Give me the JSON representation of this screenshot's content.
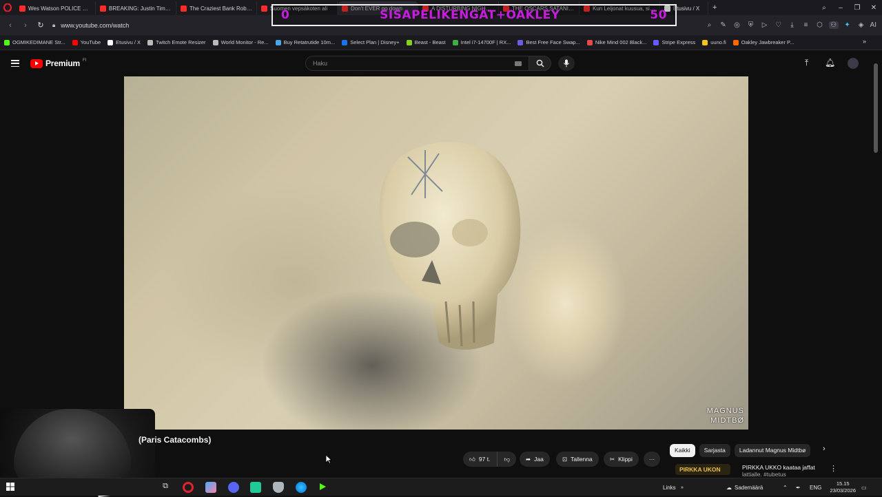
{
  "browser": {
    "tabs": [
      {
        "label": "Wes Watson POLICE REPO",
        "color": "#ff2b2b"
      },
      {
        "label": "BREAKING: Justin Timberl",
        "color": "#ff2b2b"
      },
      {
        "label": "The Craziest Bank Robber",
        "color": "#ff2b2b"
      },
      {
        "label": "Suomen vepsäkoten ali",
        "color": "#ff2b2b"
      },
      {
        "label": "Don't EVER go down",
        "color": "#ff2b2b"
      },
      {
        "label": "A DISTURBING NIGHT SH",
        "color": "#ff2b2b"
      },
      {
        "label": "THE OSCARS SATANIC R",
        "color": "#ff2b2b"
      },
      {
        "label": "Kun Leijonat kuusua, siito",
        "color": "#ff2b2b"
      },
      {
        "label": "Etusivu / X",
        "color": "#ffffff"
      }
    ],
    "new_tab": "+",
    "url": "www.youtube.com/watch",
    "ai_label": "AI",
    "bookmarks": [
      {
        "label": "OGMIKEDIMANE Str...",
        "color": "#53fc18"
      },
      {
        "label": "YouTube",
        "color": "#ff0000"
      },
      {
        "label": "Etusivu / X",
        "color": "#ffffff"
      },
      {
        "label": "Twitch Emote Resizer",
        "color": "#bbbbbb"
      },
      {
        "label": "World Monitor - Re...",
        "color": "#bbbbbb"
      },
      {
        "label": "Buy Retatrutide 10m...",
        "color": "#49a6e9"
      },
      {
        "label": "Select Plan | Disney+",
        "color": "#1a73e8"
      },
      {
        "label": "Beast - Beast",
        "color": "#7ed321"
      },
      {
        "label": "Intel i7-14700F | RX...",
        "color": "#3cb043"
      },
      {
        "label": "Best Free Face Swap...",
        "color": "#6b5ce7"
      },
      {
        "label": "Nike Mind 002 Black...",
        "color": "#e34b4b"
      },
      {
        "label": "Stripe Express",
        "color": "#635bff"
      },
      {
        "label": "uuno.fi",
        "color": "#f5c518"
      },
      {
        "label": "Oakley Jawbreaker P...",
        "color": "#ff6a00"
      }
    ]
  },
  "overlay": {
    "left": "0",
    "center": "SISAPELIKENGÄT+OAKLEY",
    "right": "50"
  },
  "youtube": {
    "brand": "Premium",
    "country_code": "FI",
    "search_placeholder": "Haku",
    "video_title": "(Paris Catacombs)",
    "watermark_line1": "MAGNUS",
    "watermark_line2": "MIDTBØ",
    "actions": {
      "likes": "97 t.",
      "share": "Jaa",
      "save": "Tallenna",
      "clip": "Klippi",
      "more": "···"
    },
    "chips": [
      "Kaikki",
      "Sarjasta",
      "Ladannut Magnus Midtbø"
    ],
    "recommendation": {
      "thumb_text": "PIRKKA UKON",
      "title_line1": "PIRKKA UKKO kaataa jaffat",
      "title_line2": "lattialle. #tubetus"
    }
  },
  "taskbar": {
    "links": "Links",
    "weather": "Sademäärä",
    "lang": "ENG",
    "time": "15.15",
    "date": "23/03/2026"
  },
  "colors": {
    "overlay_text": "#c81be0",
    "yt_red": "#ff0000"
  }
}
